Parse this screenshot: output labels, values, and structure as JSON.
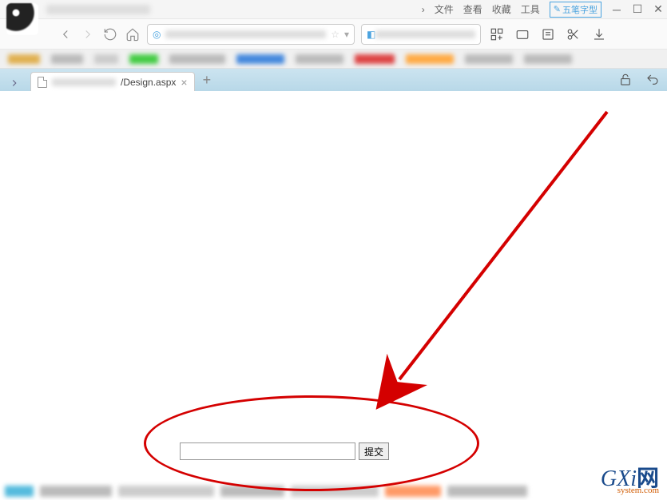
{
  "titlebar": {
    "menu": {
      "file": "文件",
      "view": "查看",
      "favorites": "收藏",
      "tools": "工具"
    },
    "ime_label": "五笔字型"
  },
  "tab": {
    "title_suffix": "/Design.aspx"
  },
  "page": {
    "input_value": "",
    "submit_label": "提交"
  },
  "watermark": {
    "main_prefix": "GXi",
    "main_suffix": "网",
    "sub": "system.com"
  }
}
